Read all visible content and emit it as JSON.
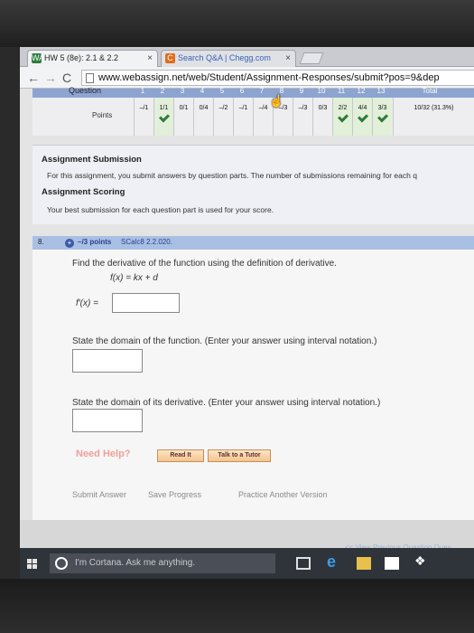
{
  "browser": {
    "tabs": [
      {
        "favicon": "WA",
        "title": "HW 5 (8e): 2.1 & 2.2",
        "close": "×"
      },
      {
        "favicon": "C",
        "title": "Search Q&A | Chegg.com",
        "close": "×"
      }
    ],
    "nav": {
      "back": "←",
      "forward": "→",
      "reload": "C"
    },
    "url": "www.webassign.net/web/Student/Assignment-Responses/submit?pos=9&dep"
  },
  "scores": {
    "question_label": "Question",
    "question_numbers": [
      "1",
      "2",
      "3",
      "4",
      "5",
      "6",
      "7",
      "8",
      "9",
      "10",
      "11",
      "12",
      "13"
    ],
    "total_label": "Total",
    "points_label": "Points",
    "points": [
      {
        "value": "–/1",
        "checked": false
      },
      {
        "value": "1/1",
        "checked": true
      },
      {
        "value": "0/1",
        "checked": false
      },
      {
        "value": "0/4",
        "checked": false
      },
      {
        "value": "–/2",
        "checked": false
      },
      {
        "value": "–/1",
        "checked": false
      },
      {
        "value": "–/4",
        "checked": false
      },
      {
        "value": "–/3",
        "checked": false
      },
      {
        "value": "–/3",
        "checked": false
      },
      {
        "value": "0/3",
        "checked": false
      },
      {
        "value": "2/2",
        "checked": true
      },
      {
        "value": "4/4",
        "checked": true
      },
      {
        "value": "3/3",
        "checked": true
      }
    ],
    "total": "10/32 (31.3%)"
  },
  "submission": {
    "heading": "Assignment Submission",
    "text": "For this assignment, you submit answers by question parts. The number of submissions remaining for each q",
    "scoring_heading": "Assignment Scoring",
    "scoring_text": "Your best submission for each question part is used for your score."
  },
  "question": {
    "number": "8.",
    "points": "–/3 points",
    "source": "SCalc8 2.2.020.",
    "prompt": "Find the derivative of the function using the definition of derivative.",
    "function": "f(x) = kx + d",
    "derivative_label": "f′(x) =",
    "domain_prompt": "State the domain of the function. (Enter your answer using interval notation.)",
    "deriv_domain_prompt": "State the domain of its derivative. (Enter your answer using interval notation.)",
    "help_label": "Need Help?",
    "read_it": "Read It",
    "talk_tutor": "Talk to a Tutor",
    "submit": "Submit Answer",
    "save": "Save Progress",
    "practice": "Practice Another Version",
    "view_previous": "<< View Previous Question  Ques"
  },
  "taskbar": {
    "cortana_placeholder": "I'm Cortana. Ask me anything."
  }
}
